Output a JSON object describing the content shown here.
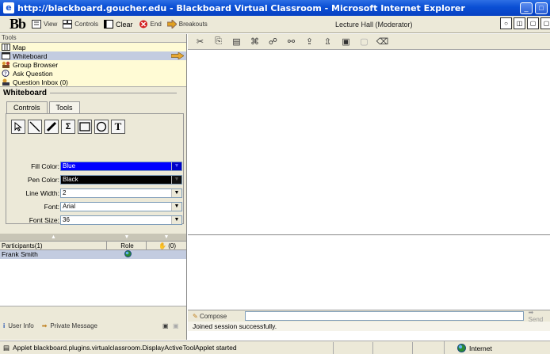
{
  "window": {
    "title": "http://blackboard.goucher.edu - Blackboard Virtual Classroom - Microsoft Internet Explorer",
    "minimize": "_",
    "maximize": "□"
  },
  "toolbar": {
    "logo": "Bb",
    "items": [
      {
        "label": "View",
        "icon": "view-icon"
      },
      {
        "label": "Controls",
        "icon": "controls-icon"
      },
      {
        "label": "Clear",
        "icon": "clear-icon"
      },
      {
        "label": "End",
        "icon": "end-icon"
      },
      {
        "label": "Breakouts",
        "icon": "breakouts-icon"
      }
    ],
    "lecture_hall": "Lecture Hall (Moderator)"
  },
  "tools": {
    "header": "Tools",
    "items": [
      {
        "label": "Map",
        "icon": "map-icon",
        "selected": false
      },
      {
        "label": "Whiteboard",
        "icon": "whiteboard-icon",
        "selected": true
      },
      {
        "label": "Group Browser",
        "icon": "group-icon",
        "selected": false
      },
      {
        "label": "Ask Question",
        "icon": "question-icon",
        "selected": false
      },
      {
        "label": "Question Inbox (0)",
        "icon": "inbox-icon",
        "selected": false
      }
    ]
  },
  "whiteboard": {
    "title": "Whiteboard",
    "tabs": [
      {
        "label": "Controls",
        "active": false
      },
      {
        "label": "Tools",
        "active": true
      }
    ],
    "shapes": [
      "pointer-icon",
      "line-icon",
      "pen-icon",
      "sigma-icon",
      "rectangle-icon",
      "ellipse-icon",
      "text-icon"
    ],
    "text_tool_glyph": "T",
    "sigma_glyph": "Σ",
    "props": {
      "fill_color_label": "Fill Color:",
      "fill_color_value": "Blue",
      "fill_color_hex": "#0000ff",
      "pen_color_label": "Pen Color:",
      "pen_color_value": "Black",
      "pen_color_hex": "#000000",
      "line_width_label": "Line Width:",
      "line_width_value": "2",
      "font_label": "Font:",
      "font_value": "Arial",
      "font_size_label": "Font Size:",
      "font_size_value": "36"
    }
  },
  "participants": {
    "columns": {
      "name": "Participants(1)",
      "role": "Role",
      "hands": "(0)"
    },
    "rows": [
      {
        "name": "Frank Smith",
        "role_icon": "globe-icon"
      }
    ],
    "footer": {
      "user_info": "User Info",
      "private_message": "Private Message"
    }
  },
  "chat": {
    "compose_label": "Compose",
    "send_label": "Send",
    "session_message": "Joined session successfully."
  },
  "status": {
    "message": "Applet blackboard.plugins.virtualclassroom.DisplayActiveToolApplet started",
    "zone": "Internet"
  },
  "colors": {
    "titlebar": "#0a4fd4",
    "selection": "#c3cce0",
    "tools_bg": "#fffbd5"
  }
}
